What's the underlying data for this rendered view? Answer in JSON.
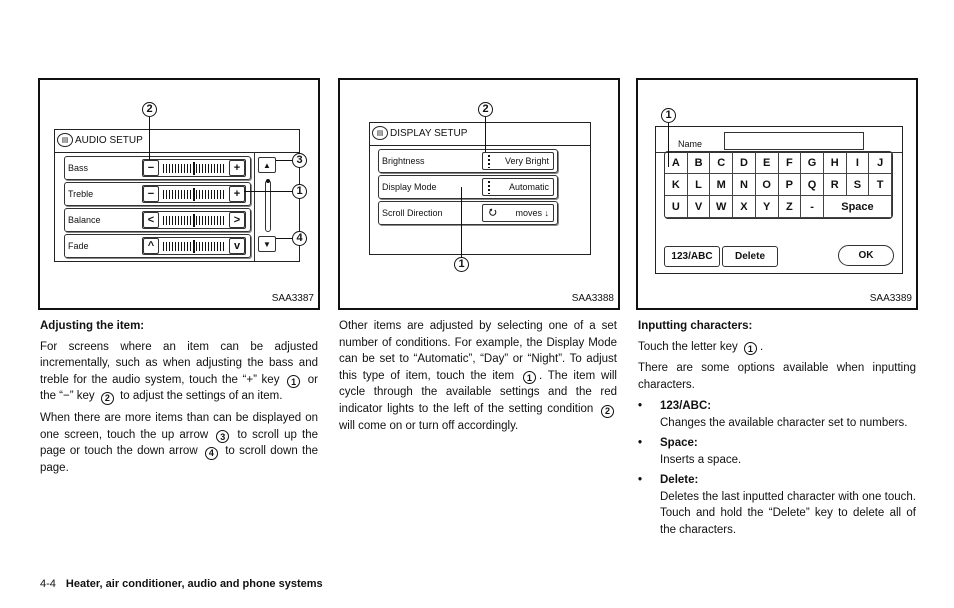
{
  "figures": {
    "audio": {
      "code": "SAA3387",
      "title": "AUDIO SETUP",
      "rows": [
        {
          "label": "Bass",
          "left": "−",
          "right": "+"
        },
        {
          "label": "Treble",
          "left": "−",
          "right": "+"
        },
        {
          "label": "Balance",
          "left": "<",
          "right": ">"
        },
        {
          "label": "Fade",
          "left": "^",
          "right": "v"
        }
      ],
      "scroll_up": "▲",
      "scroll_down": "▼",
      "callouts": [
        "2",
        "3",
        "1",
        "4"
      ]
    },
    "display": {
      "code": "SAA3388",
      "title": "DISPLAY SETUP",
      "rows": [
        {
          "label": "Brightness",
          "value": "Very Bright"
        },
        {
          "label": "Display Mode",
          "value": "Automatic"
        },
        {
          "label": "Scroll Direction",
          "value": "moves ↓",
          "icon": "⭮"
        }
      ],
      "callouts": [
        "2",
        "1"
      ]
    },
    "keyboard": {
      "code": "SAA3389",
      "name_label": "Name",
      "name_value": "",
      "keys": [
        "A",
        "B",
        "C",
        "D",
        "E",
        "F",
        "G",
        "H",
        "I",
        "J",
        "K",
        "L",
        "M",
        "N",
        "O",
        "P",
        "Q",
        "R",
        "S",
        "T",
        "U",
        "V",
        "W",
        "X",
        "Y",
        "Z",
        "-"
      ],
      "space_label": "Space",
      "toggle_label": "123/ABC",
      "delete_label": "Delete",
      "ok_label": "OK",
      "callouts": [
        "1"
      ]
    }
  },
  "col1": {
    "heading": "Adjusting the item:",
    "p1a": "For screens where an item can be adjusted incrementally, such as when adjusting the bass and treble for the audio system, touch the “+” key",
    "p1b": "or the “−” key",
    "p1c": "to adjust the settings of an item.",
    "p2a": "When there are more items than can be displayed on one screen, touch the up arrow",
    "p2b": "to scroll up the page or touch the down arrow",
    "p2c": "to scroll down the page.",
    "refs": [
      "1",
      "2",
      "3",
      "4"
    ]
  },
  "col2": {
    "p1a": "Other items are adjusted by selecting one of a set number of conditions. For example, the Display Mode can be set to “Automatic”, “Day” or “Night”. To adjust this type of item, touch the item",
    "p1b": ". The item will cycle through the available settings and the red indicator lights to the left of the setting condition",
    "p1c": "will come on or turn off accordingly.",
    "refs": [
      "1",
      "2"
    ]
  },
  "col3": {
    "heading": "Inputting characters:",
    "p1a": "Touch the letter key",
    "p1b": ".",
    "p2": "There are some options available when inputting characters.",
    "refs": [
      "1"
    ],
    "bullets": [
      {
        "head": "123/ABC:",
        "body": "Changes the available character set to numbers."
      },
      {
        "head": "Space:",
        "body": "Inserts a space."
      },
      {
        "head": "Delete:",
        "body": "Deletes the last inputted character with one touch. Touch and hold the “Delete” key to delete all of the characters."
      }
    ]
  },
  "footer": {
    "page": "4-4",
    "section": "Heater, air conditioner, audio and phone systems"
  }
}
